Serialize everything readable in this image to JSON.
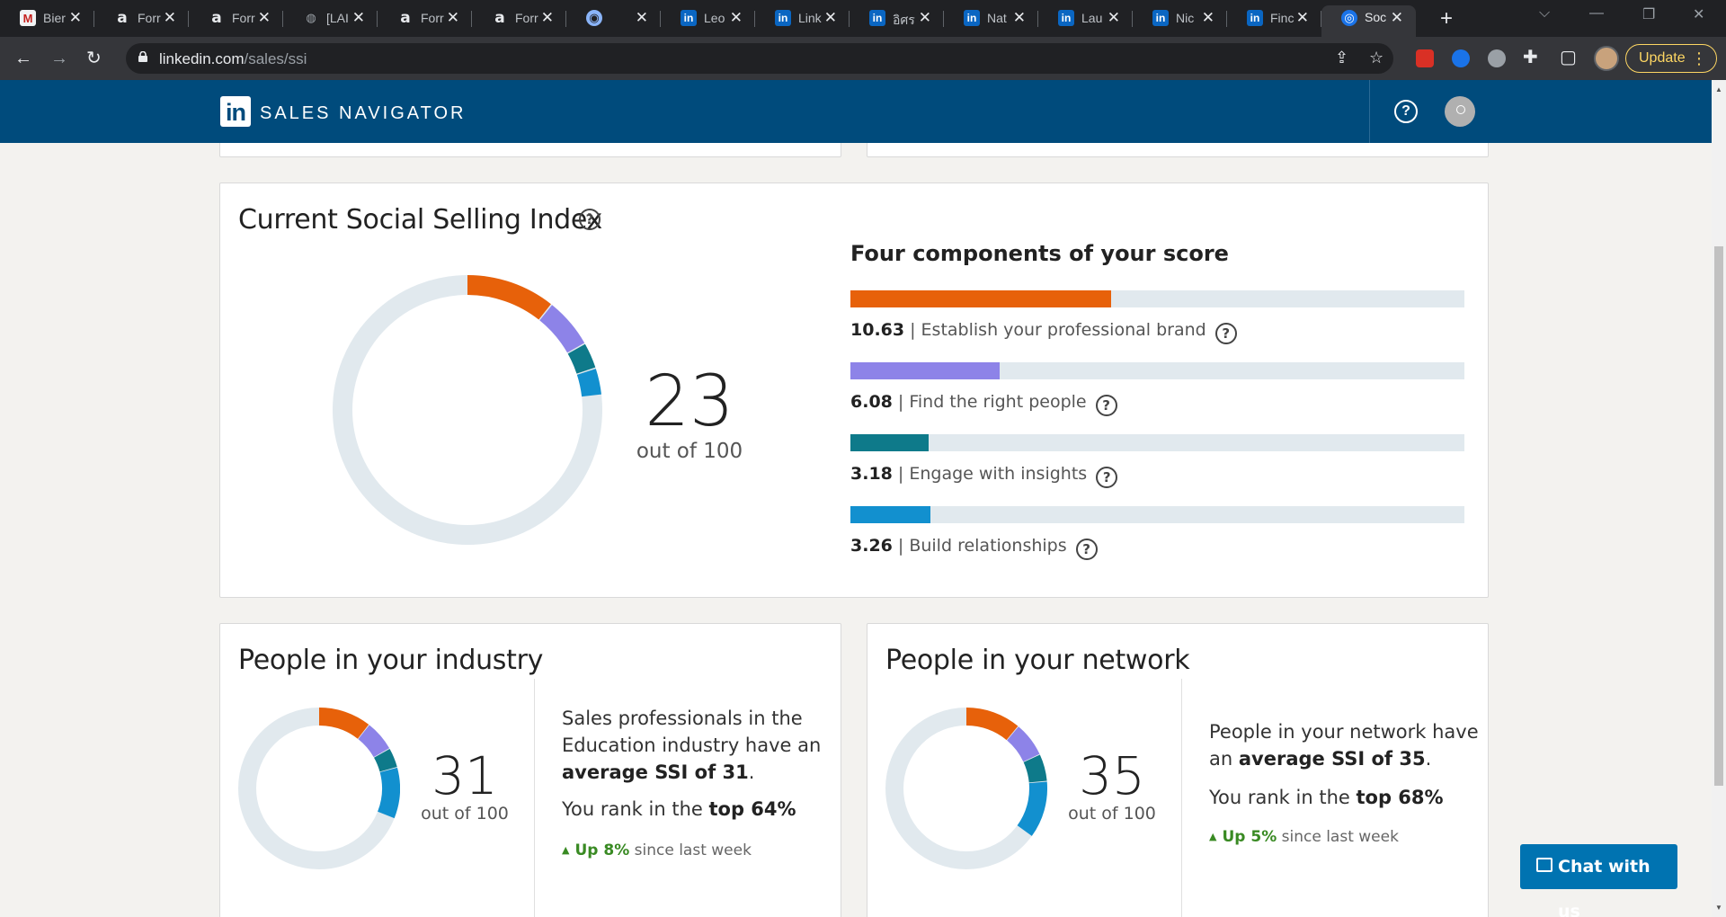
{
  "browser": {
    "tabs": [
      {
        "icon": "gmail-icon",
        "label": "Bier"
      },
      {
        "icon": "a-icon",
        "label": "Forr"
      },
      {
        "icon": "a-icon",
        "label": "Forr"
      },
      {
        "icon": "globe-icon",
        "label": "[LAI"
      },
      {
        "icon": "a-icon",
        "label": "Forr"
      },
      {
        "icon": "a-icon",
        "label": "Forr"
      },
      {
        "icon": "colorful-icon",
        "label": ""
      },
      {
        "icon": "linkedin-icon",
        "label": "Leo"
      },
      {
        "icon": "linkedin-icon",
        "label": "Link"
      },
      {
        "icon": "linkedin-icon",
        "label": "อิศร"
      },
      {
        "icon": "linkedin-icon",
        "label": "Nat"
      },
      {
        "icon": "linkedin-icon",
        "label": "Lau"
      },
      {
        "icon": "linkedin-icon",
        "label": "Nic"
      },
      {
        "icon": "linkedin-icon",
        "label": "Finc"
      },
      {
        "icon": "compass-icon",
        "label": "Soc",
        "active": true
      }
    ],
    "url_host": "linkedin.com",
    "url_path": "/sales/ssi",
    "update_label": "Update"
  },
  "header": {
    "logo": "in",
    "title": "SALES NAVIGATOR"
  },
  "ssi": {
    "title": "Current Social Selling Index",
    "score": "23",
    "out_of": "out of 100",
    "components_title": "Four components of your score",
    "components": [
      {
        "value": "10.63",
        "label": "| Establish your professional brand",
        "score": 10.63,
        "max": 25,
        "color": "#e7610a"
      },
      {
        "value": "6.08",
        "label": "| Find the right people",
        "score": 6.08,
        "max": 25,
        "color": "#8d83e8"
      },
      {
        "value": "3.18",
        "label": "| Engage with insights",
        "score": 3.18,
        "max": 25,
        "color": "#0e7a8a"
      },
      {
        "value": "3.26",
        "label": "| Build relationships",
        "score": 3.26,
        "max": 25,
        "color": "#1290cf"
      }
    ]
  },
  "industry": {
    "title": "People in your industry",
    "score": "31",
    "out_of": "out of 100",
    "components": [
      10.5,
      6.2,
      4.0,
      10.3
    ],
    "desc_pre": "Sales professionals in the Education industry have an ",
    "desc_bold": "average SSI of 31",
    "desc_post": ".",
    "rank_pre": "You rank in the ",
    "rank_bold": "top 64%",
    "trend_up": "Up 8%",
    "trend_post": " since last week"
  },
  "network": {
    "title": "People in your network",
    "score": "35",
    "out_of": "out of 100",
    "components": [
      11.0,
      7.0,
      5.5,
      11.5
    ],
    "desc_pre": "People in your network have an ",
    "desc_bold": "average SSI of 35",
    "desc_post": ".",
    "rank_pre": "You rank in the ",
    "rank_bold": "top 68%",
    "trend_up": "Up 5%",
    "trend_post": " since last week"
  },
  "chat": {
    "label": "Chat with us"
  },
  "colors": {
    "brand": "#e7610a",
    "find": "#8d83e8",
    "engage": "#0e7a8a",
    "build": "#1290cf",
    "track": "#e1e9ee",
    "header_bg": "#004b7c"
  }
}
